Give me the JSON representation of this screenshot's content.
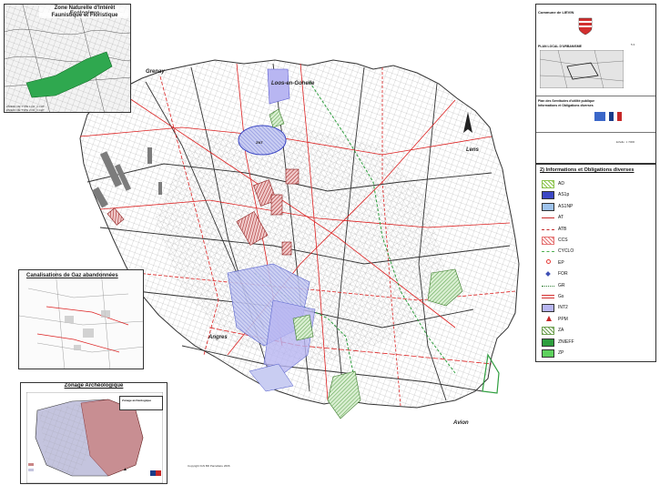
{
  "places": {
    "grenay": "Grenay",
    "loos": "Loos-en-Gohelle",
    "lens": "Lens",
    "angres": "Angres",
    "avion": "Avion",
    "znt": "ZNT"
  },
  "insets": {
    "znieff": {
      "title_l1": "Zone Naturelle d'Intérêt Ecologique",
      "title_l2": "Faunistique et Floristique",
      "note_l1": "ZNIEFF DE TYPE 1 FR_1 CHT",
      "note_l2": "ZNIEFF DE TYPE 2 FR_1 CHT"
    },
    "gas": {
      "title": "Canalisations de Gaz abandonnées"
    },
    "zonage": {
      "title": "Zonage Archéologique",
      "legend_title": "Zonage archéologique"
    }
  },
  "cartouche": {
    "commune": "Commune de LIEVIN",
    "plu": "PLAN LOCAL D'URBANISME",
    "plan_title_l1": "Plan des Servitudes d'utilité publique",
    "plan_title_l2": "Informations et Obligations diverses",
    "piece_num": "5.3",
    "scale": "Echelle : 1 / 5000"
  },
  "legend": {
    "title": "2) Informations et Obligations diverses",
    "items": [
      {
        "code": "AD",
        "color": "#8bc34a",
        "style": "hatch"
      },
      {
        "code": "AS1p",
        "color": "#3b47c4",
        "style": "solid"
      },
      {
        "code": "AS1NP",
        "color": "#9ec3ec",
        "style": "solid"
      },
      {
        "code": "AT",
        "color": "#c62828",
        "style": "line"
      },
      {
        "code": "ATB",
        "color": "#c62828",
        "style": "dash"
      },
      {
        "code": "CCS",
        "color": "#e57373",
        "style": "hatch"
      },
      {
        "code": "CYCLO",
        "color": "#4caf50",
        "style": "dash"
      },
      {
        "code": "EP",
        "color": "#e53935",
        "style": "ring"
      },
      {
        "code": "FOR",
        "color": "#3f51b5",
        "style": "dot"
      },
      {
        "code": "GR",
        "color": "#2e7d32",
        "style": "cross"
      },
      {
        "code": "Gs",
        "color": "#d32f2f",
        "style": "double"
      },
      {
        "code": "INT2",
        "color": "#b8b6f2",
        "style": "solid"
      },
      {
        "code": "PPM",
        "color": "#c62828",
        "style": "triangle"
      },
      {
        "code": "ZA",
        "color": "#6d9e4f",
        "style": "hatch"
      },
      {
        "code": "ZNIEFF",
        "color": "#2e9e3e",
        "style": "solid"
      },
      {
        "code": "ZP",
        "color": "#5ed15e",
        "style": "solid"
      }
    ]
  },
  "copyright": "Copyright IGN BD Parcellaire 2006"
}
